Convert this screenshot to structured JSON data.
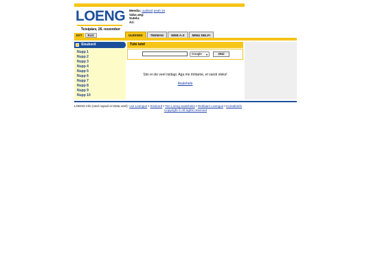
{
  "header": {
    "logo_text": "LOENG",
    "date": "Teisipäev, 26. november",
    "meta": [
      {
        "label": "Meedia:",
        "links": [
          "uudised",
          "pealt 16"
        ]
      },
      {
        "label": "Vaba aeg:",
        "links": []
      },
      {
        "label": "Sutelu:",
        "links": []
      },
      {
        "label": "Äri:",
        "links": []
      }
    ]
  },
  "lang": [
    "EST",
    "RUS"
  ],
  "tabs": [
    {
      "label": "UUDISED",
      "active": true
    },
    {
      "label": "TEEMAD",
      "active": false
    },
    {
      "label": "WEB A-Z",
      "active": false
    },
    {
      "label": "MINU DELFI",
      "active": false
    }
  ],
  "sidebar": {
    "title": "Sisukord",
    "items": [
      "Nupp 1",
      "Nupp 2",
      "Nupp 3",
      "Nupp 4",
      "Nupp 5",
      "Nupp 6",
      "Nupp 7",
      "Nupp 8",
      "Nupp 9",
      "Nupp 10"
    ]
  },
  "main": {
    "title": "Tühi leht!",
    "search": {
      "input_value": "",
      "engine": "Google",
      "button": "Otsi"
    },
    "message": "Siin ei ole veel midagi. Aga me töötame, et varsti oleks!",
    "home_link": "Avalehele"
  },
  "footer": {
    "prefix": "LOENG info (veel nupud ei tööta veel):",
    "links": [
      "Uut Loengus",
      "Sisukord",
      "Tee Loeng avaleheks",
      "Reklaam Loengus",
      "Kontaktinfo"
    ],
    "separator": " • ",
    "copyright": "Copyright © All rights reserved"
  },
  "colors": {
    "accent_yellow": "#f5c518",
    "brand_blue": "#1b4f9c",
    "link_blue": "#1a3ea8",
    "sidebar_bg": "#fdfbc8"
  }
}
